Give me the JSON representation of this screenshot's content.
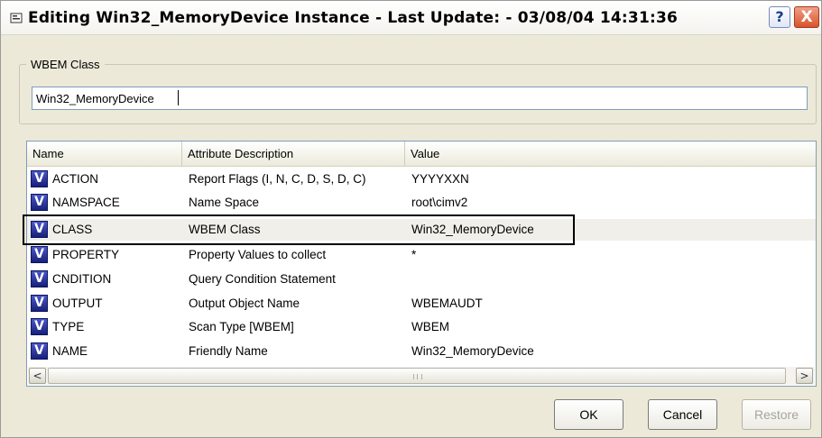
{
  "window": {
    "title": "Editing Win32_MemoryDevice Instance - Last Update: - 03/08/04 14:31:36",
    "help_label": "?",
    "close_label": "X"
  },
  "group": {
    "legend": "WBEM Class",
    "value": "Win32_MemoryDevice"
  },
  "list": {
    "columns": [
      "Name",
      "Attribute Description",
      "Value"
    ],
    "icon_letter": "V",
    "rows": [
      {
        "name": "ACTION",
        "description": "Report Flags (I, N, C, D, S, D, C)",
        "value": "YYYYXXN"
      },
      {
        "name": "NAMSPACE",
        "description": "Name Space",
        "value": "root\\cimv2"
      },
      {
        "name": "CLASS",
        "description": "WBEM Class",
        "value": "Win32_MemoryDevice"
      },
      {
        "name": "PROPERTY",
        "description": "Property Values to collect",
        "value": "*"
      },
      {
        "name": "CNDITION",
        "description": "Query Condition Statement",
        "value": ""
      },
      {
        "name": "OUTPUT",
        "description": "Output Object Name",
        "value": "WBEMAUDT"
      },
      {
        "name": "TYPE",
        "description": "Scan Type [WBEM]",
        "value": "WBEM"
      },
      {
        "name": "NAME",
        "description": "Friendly Name",
        "value": "Win32_MemoryDevice"
      }
    ],
    "scroll_left": "<",
    "scroll_right": ">"
  },
  "buttons": {
    "ok": "OK",
    "cancel": "Cancel",
    "restore": "Restore"
  },
  "colors": {
    "window_bg": "#ece9d8",
    "icon_blue": "#1e2a8f",
    "close_red": "#d8532b"
  }
}
